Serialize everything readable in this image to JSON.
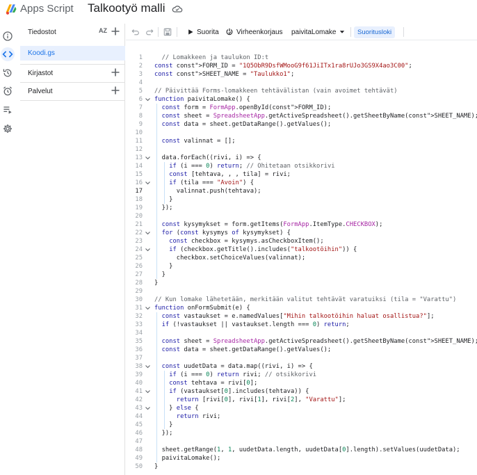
{
  "header": {
    "app_name": "Apps Script",
    "project_title": "Talkootyö malli"
  },
  "rail": [
    {
      "name": "info-icon"
    },
    {
      "name": "code-icon"
    },
    {
      "name": "history-icon"
    },
    {
      "name": "triggers-icon"
    },
    {
      "name": "executions-icon"
    },
    {
      "name": "settings-icon"
    }
  ],
  "files_panel": {
    "files_label": "Tiedostot",
    "sort_label": "AZ",
    "file_name": "Koodi.gs",
    "libraries_label": "Kirjastot",
    "services_label": "Palvelut"
  },
  "toolbar": {
    "run_label": "Suorita",
    "debug_label": "Virheenkorjaus",
    "function_select": "paivitaLomake",
    "log_label": "Suoritusloki"
  },
  "editor": {
    "active_line": 17,
    "lines": [
      {
        "n": "1",
        "t": "  // Lomakkeen ja taulukon ID:t"
      },
      {
        "n": "2",
        "t": "const FORM_ID = \"1Q5ObR9DsfWMooG9f61JiITx1ra8rUJo3GS9X4ao3C00\";"
      },
      {
        "n": "3",
        "t": "const SHEET_NAME = \"Taulukko1\";"
      },
      {
        "n": "4",
        "t": ""
      },
      {
        "n": "5",
        "t": "// Päivittää Forms-lomakkeen tehtävälistan (vain avoimet tehtävät)"
      },
      {
        "n": "6",
        "t": "function paivitaLomake() {"
      },
      {
        "n": "7",
        "t": "  const form = FormApp.openById(FORM_ID);"
      },
      {
        "n": "8",
        "t": "  const sheet = SpreadsheetApp.getActiveSpreadsheet().getSheetByName(SHEET_NAME);"
      },
      {
        "n": "9",
        "t": "  const data = sheet.getDataRange().getValues();"
      },
      {
        "n": "10",
        "t": ""
      },
      {
        "n": "11",
        "t": "  const valinnat = [];"
      },
      {
        "n": "12",
        "t": ""
      },
      {
        "n": "13",
        "t": "  data.forEach((rivi, i) => {"
      },
      {
        "n": "14",
        "t": "    if (i === 0) return; // Ohitetaan otsikkorivi"
      },
      {
        "n": "15",
        "t": "    const [tehtava, , , tila] = rivi;"
      },
      {
        "n": "16",
        "t": "    if (tila === \"Avoin\") {"
      },
      {
        "n": "17",
        "t": "      valinnat.push(tehtava);"
      },
      {
        "n": "18",
        "t": "    }"
      },
      {
        "n": "19",
        "t": "  });"
      },
      {
        "n": "20",
        "t": ""
      },
      {
        "n": "21",
        "t": "  const kysymykset = form.getItems(FormApp.ItemType.CHECKBOX);"
      },
      {
        "n": "22",
        "t": "  for (const kysymys of kysymykset) {"
      },
      {
        "n": "23",
        "t": "    const checkbox = kysymys.asCheckboxItem();"
      },
      {
        "n": "24",
        "t": "    if (checkbox.getTitle().includes(\"talkootöihin\")) {"
      },
      {
        "n": "25",
        "t": "      checkbox.setChoiceValues(valinnat);"
      },
      {
        "n": "26",
        "t": "    }"
      },
      {
        "n": "27",
        "t": "  }"
      },
      {
        "n": "28",
        "t": "}"
      },
      {
        "n": "29",
        "t": ""
      },
      {
        "n": "30",
        "t": "// Kun lomake lähetetään, merkitään valitut tehtävät varatuiksi (tila = \"Varattu\")"
      },
      {
        "n": "31",
        "t": "function onFormSubmit(e) {"
      },
      {
        "n": "32",
        "t": "  const vastaukset = e.namedValues[\"Mihin talkootöihin haluat osallistua?\"];"
      },
      {
        "n": "33",
        "t": "  if (!vastaukset || vastaukset.length === 0) return;"
      },
      {
        "n": "34",
        "t": ""
      },
      {
        "n": "35",
        "t": "  const sheet = SpreadsheetApp.getActiveSpreadsheet().getSheetByName(SHEET_NAME);"
      },
      {
        "n": "36",
        "t": "  const data = sheet.getDataRange().getValues();"
      },
      {
        "n": "37",
        "t": ""
      },
      {
        "n": "38",
        "t": "  const uudetData = data.map((rivi, i) => {"
      },
      {
        "n": "39",
        "t": "    if (i === 0) return rivi; // otsikkorivi"
      },
      {
        "n": "40",
        "t": "    const tehtava = rivi[0];"
      },
      {
        "n": "41",
        "t": "    if (vastaukset[0].includes(tehtava)) {"
      },
      {
        "n": "42",
        "t": "      return [rivi[0], rivi[1], rivi[2], \"Varattu\"];"
      },
      {
        "n": "43",
        "t": "    } else {"
      },
      {
        "n": "44",
        "t": "      return rivi;"
      },
      {
        "n": "45",
        "t": "    }"
      },
      {
        "n": "46",
        "t": "  });"
      },
      {
        "n": "47",
        "t": ""
      },
      {
        "n": "48",
        "t": "  sheet.getRange(1, 1, uudetData.length, uudetData[0].length).setValues(uudetData);"
      },
      {
        "n": "49",
        "t": "  paivitaLomake();"
      },
      {
        "n": "50",
        "t": "}"
      }
    ],
    "fold_lines": [
      "6",
      "13",
      "16",
      "22",
      "24",
      "31",
      "38",
      "41",
      "43"
    ]
  }
}
